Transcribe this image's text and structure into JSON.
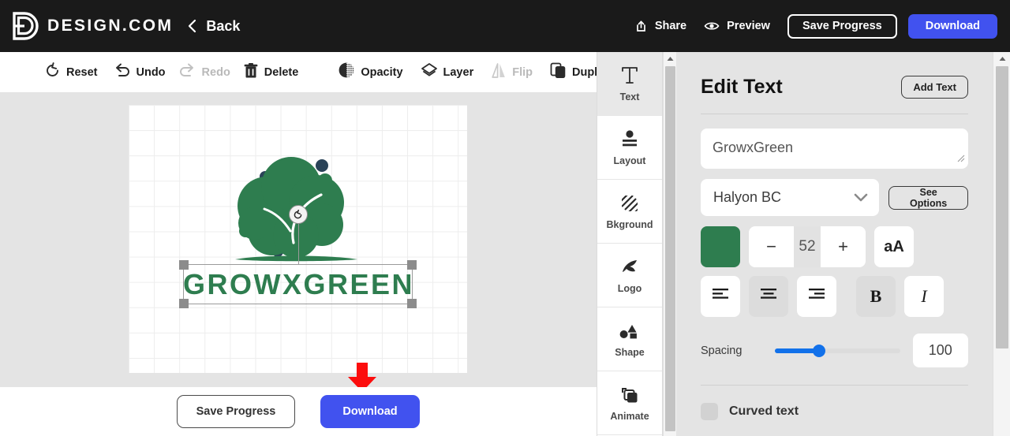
{
  "header": {
    "brand_name": "DESIGN.COM",
    "brand_logo_icon": "design-d-logo-icon",
    "back_chevron_icon": "chevron-left-icon",
    "back_label": "Back",
    "share_icon": "share-icon",
    "share_label": "Share",
    "preview_icon": "eye-icon",
    "preview_label": "Preview",
    "save_progress_label": "Save Progress",
    "download_label": "Download",
    "download_color": "#4152ef",
    "bar_color": "#1a1a1a"
  },
  "toolbar": {
    "items": [
      {
        "label": "Reset",
        "icon": "reset-circular-arrow-icon",
        "disabled": false
      },
      {
        "label": "Undo",
        "icon": "undo-arrow-icon",
        "disabled": false
      },
      {
        "label": "Redo",
        "icon": "redo-arrow-icon",
        "disabled": true
      },
      {
        "label": "Delete",
        "icon": "trash-can-icon",
        "disabled": false
      },
      {
        "label": "Opacity",
        "icon": "opacity-half-circle-icon",
        "disabled": false
      },
      {
        "label": "Layer",
        "icon": "layers-diamond-icon",
        "disabled": false
      },
      {
        "label": "Flip",
        "icon": "flip-horizontal-icon",
        "disabled": true
      },
      {
        "label": "Duplicate",
        "icon": "duplicate-copy-icon",
        "disabled": false
      }
    ]
  },
  "canvas": {
    "background": "#e4e4e4",
    "artboard_background": "#ffffff",
    "grid_color": "#ededed",
    "logo": {
      "tree_icon": "tree-logo-icon",
      "foliage_color": "#2e7d4f",
      "accent_dot_color": "#2a4358",
      "text": "GROWXGREEN",
      "text_color": "#2e7d4f"
    },
    "selection": {
      "rotate_icon": "rotate-handle-icon",
      "handle_color": "#8c8c8c",
      "border_color": "#9a9a9a"
    },
    "annotation": {
      "arrow_icon": "red-down-arrow-icon",
      "arrow_color": "#fc0d0d"
    }
  },
  "bottom_bar": {
    "save_progress_label": "Save Progress",
    "download_label": "Download",
    "download_color": "#4152ef"
  },
  "tool_rail": {
    "items": [
      {
        "label": "Text",
        "icon": "text-t-icon",
        "active": true
      },
      {
        "label": "Layout",
        "icon": "layout-lines-icon",
        "active": false
      },
      {
        "label": "Bkground",
        "icon": "hatch-pattern-icon",
        "active": false
      },
      {
        "label": "Logo",
        "icon": "logo-leaf-icon",
        "active": false
      },
      {
        "label": "Shape",
        "icon": "shapes-icon",
        "active": false
      },
      {
        "label": "Animate",
        "icon": "animate-stack-icon",
        "active": false
      }
    ]
  },
  "panel": {
    "title": "Edit Text",
    "add_text_label": "Add Text",
    "text_value": "GrowxGreen",
    "resize_grip_icon": "resize-grip-icon",
    "font_name": "Halyon BC",
    "font_chevron_icon": "chevron-down-icon",
    "see_options_label": "See Options",
    "color_swatch": "#2e7d4f",
    "font_size": "52",
    "minus_label": "−",
    "plus_label": "+",
    "case_label": "aA",
    "align_left_icon": "align-left-icon",
    "align_center_icon": "align-center-icon",
    "align_right_icon": "align-right-icon",
    "bold_label": "B",
    "italic_label": "I",
    "spacing_label": "Spacing",
    "spacing_value": "100",
    "spacing_fill_color": "#1271ea",
    "curved_text_label": "Curved text",
    "curved_text_checked": false
  },
  "scrollbars": {
    "rail_arrow_icon": "scroll-up-arrow-icon",
    "panel_arrow_icon": "scroll-up-arrow-icon",
    "thumb_color": "#c3c3c3"
  }
}
